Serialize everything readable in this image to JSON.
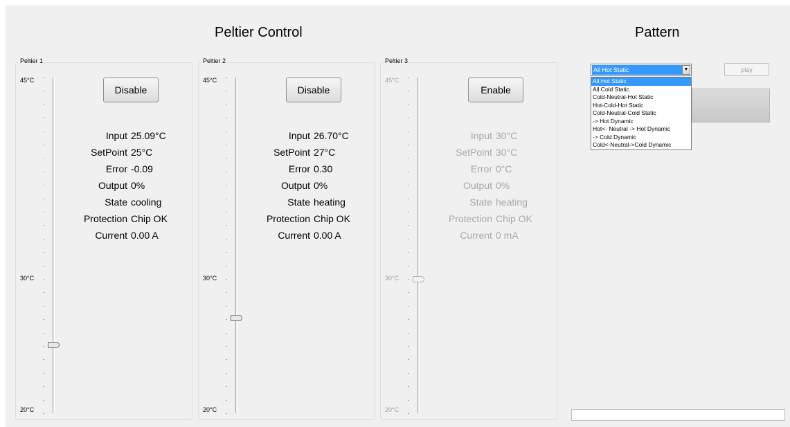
{
  "titles": {
    "peltier_control": "Peltier Control",
    "pattern": "Pattern"
  },
  "peltiers": [
    {
      "label": "Peltier 1",
      "enabled": true,
      "button": "Disable",
      "scale": {
        "max": "45°C",
        "mid": "30°C",
        "min": "20°C"
      },
      "slider_value_c": 25.1,
      "labels": {
        "input": "Input",
        "setpoint": "SetPoint",
        "error": "Error",
        "output": "Output",
        "state": "State",
        "protection": "Protection",
        "current": "Current"
      },
      "values": {
        "input": "25.09°C",
        "setpoint": "25°C",
        "error": "-0.09",
        "output": "0%",
        "state": "cooling",
        "protection": "Chip OK",
        "current": "0.00 A"
      }
    },
    {
      "label": "Peltier 2",
      "enabled": true,
      "button": "Disable",
      "scale": {
        "max": "45°C",
        "mid": "30°C",
        "min": "20°C"
      },
      "slider_value_c": 27.1,
      "labels": {
        "input": "Input",
        "setpoint": "SetPoint",
        "error": "Error",
        "output": "Output",
        "state": "State",
        "protection": "Protection",
        "current": "Current"
      },
      "values": {
        "input": "26.70°C",
        "setpoint": "27°C",
        "error": "0.30",
        "output": "0%",
        "state": "heating",
        "protection": "Chip OK",
        "current": "0.00 A"
      }
    },
    {
      "label": "Peltier 3",
      "enabled": false,
      "button": "Enable",
      "scale": {
        "max": "45°C",
        "mid": "30°C",
        "min": "20°C"
      },
      "slider_value_c": 30,
      "labels": {
        "input": "Input",
        "setpoint": "SetPoint",
        "error": "Error",
        "output": "Output",
        "state": "State",
        "protection": "Protection",
        "current": "Current"
      },
      "values": {
        "input": "30°C",
        "setpoint": "30°C",
        "error": "0°C",
        "output": "0%",
        "state": "heating",
        "protection": "Chip OK",
        "current": "0 mA"
      }
    }
  ],
  "pattern": {
    "selected": "All Hot Static",
    "options": [
      "All Hot Static",
      "All Cold Static",
      "Cold-Neutral-Hot Static",
      "Hot-Cold-Hot Static",
      "Cold-Neutral-Cold Static",
      " -> Hot Dynamic",
      "Hot<- Neutral -> Hot Dynamic",
      "-> Cold Dynamic",
      "Cold<-Neutral->Cold Dynamic"
    ],
    "play_label": "play"
  },
  "colors": {
    "selection": "#3399ff",
    "window_bg": "#f0f0f0",
    "disabled_text": "#a8a8a8"
  }
}
